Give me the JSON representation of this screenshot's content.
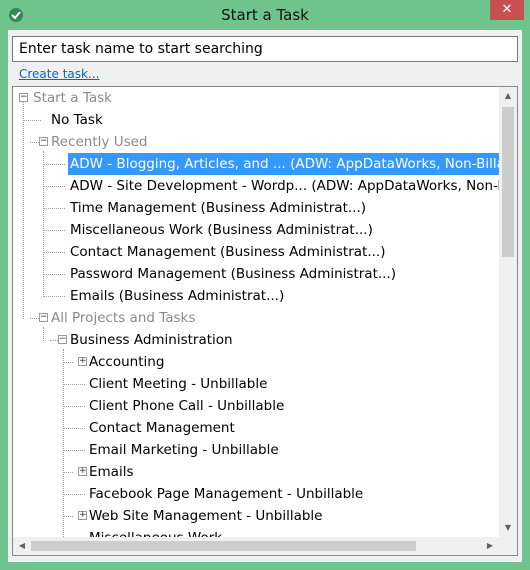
{
  "window": {
    "title": "Start a Task",
    "close_glyph": "✕"
  },
  "search": {
    "placeholder": "Enter task name to start searching",
    "value": "Enter task name to start searching"
  },
  "create_link": "Create task...",
  "tree": {
    "root": "Start a Task",
    "no_task": "No Task",
    "recently_used": {
      "label": "Recently Used",
      "items": [
        "ADW - Blogging, Articles, and ... (ADW: AppDataWorks, Non-Billable",
        "ADW - Site Development - Wordp... (ADW: AppDataWorks, Non-Billable",
        "Time Management (Business Administrat...)",
        "Miscellaneous Work (Business Administrat...)",
        "Contact Management (Business Administrat...)",
        "Password Management (Business Administrat...)",
        "Emails (Business Administrat...)"
      ],
      "selected_index": 0
    },
    "all_projects": {
      "label": "All Projects and Tasks",
      "business_admin": {
        "label": "Business Administration",
        "children": [
          {
            "label": "Accounting",
            "expandable": true
          },
          {
            "label": "Client Meeting - Unbillable",
            "expandable": false
          },
          {
            "label": "Client Phone Call - Unbillable",
            "expandable": false
          },
          {
            "label": "Contact Management",
            "expandable": false
          },
          {
            "label": "Email Marketing - Unbillable",
            "expandable": false
          },
          {
            "label": "Emails",
            "expandable": true
          },
          {
            "label": "Facebook Page Management - Unbillable",
            "expandable": false
          },
          {
            "label": "Web Site Management - Unbillable",
            "expandable": true
          },
          {
            "label": "Miscellaneous Work",
            "expandable": false
          }
        ]
      }
    }
  },
  "colors": {
    "frame": "#6ec48c",
    "selection": "#3399ff",
    "link": "#0066cc",
    "close": "#c75050"
  }
}
